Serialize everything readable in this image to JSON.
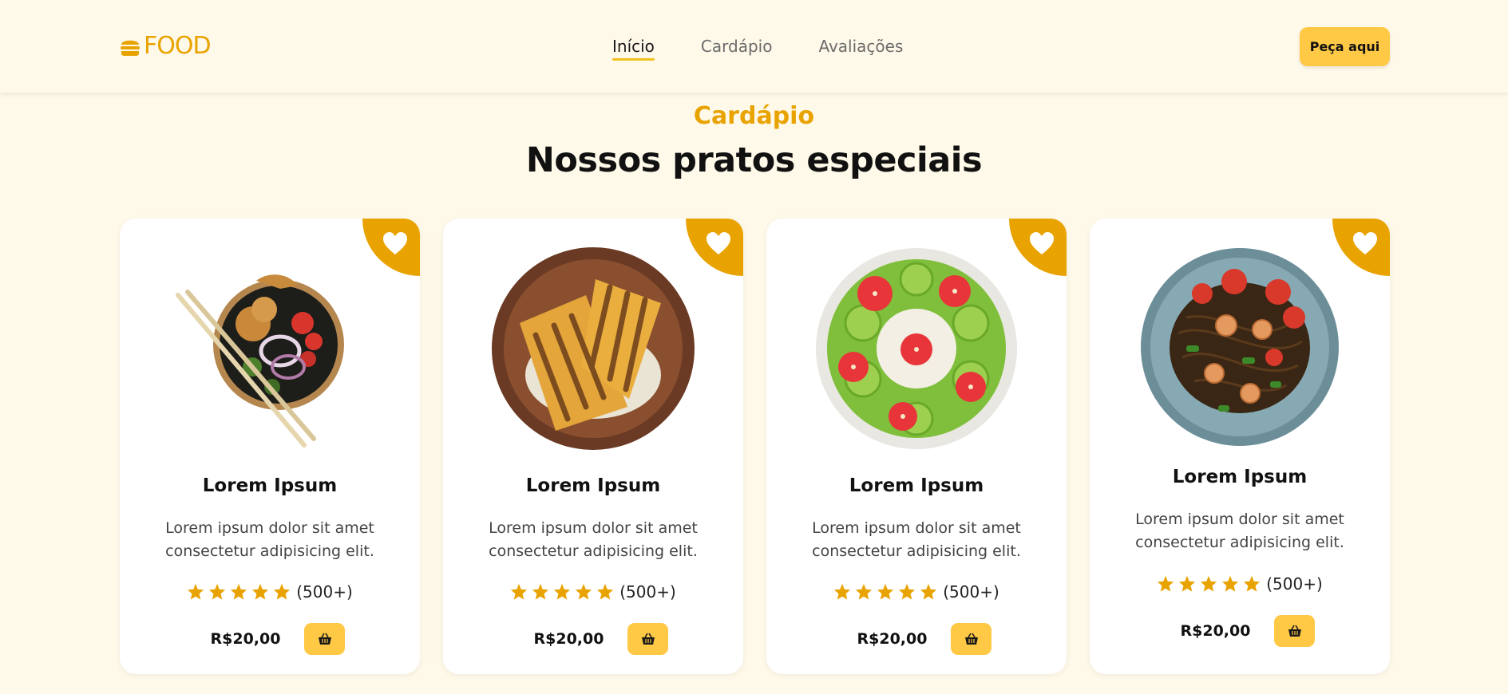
{
  "header": {
    "logo_text": "FOOD",
    "nav": [
      {
        "label": "Início",
        "active": true
      },
      {
        "label": "Cardápio",
        "active": false
      },
      {
        "label": "Avaliações",
        "active": false
      }
    ],
    "order_button": "Peça aqui"
  },
  "section": {
    "label": "Cardápio",
    "title": "Nossos pratos especiais"
  },
  "cards": [
    {
      "name": "Lorem Ipsum",
      "description": "Lorem ipsum dolor sit amet consectetur adipisicing elit.",
      "stars": 5,
      "rating_count": "(500+)",
      "price": "R$20,00",
      "dish_icon": "poke-bowl-icon"
    },
    {
      "name": "Lorem Ipsum",
      "description": "Lorem ipsum dolor sit amet consectetur adipisicing elit.",
      "stars": 5,
      "rating_count": "(500+)",
      "price": "R$20,00",
      "dish_icon": "grilled-sandwich-icon"
    },
    {
      "name": "Lorem Ipsum",
      "description": "Lorem ipsum dolor sit amet consectetur adipisicing elit.",
      "stars": 5,
      "rating_count": "(500+)",
      "price": "R$20,00",
      "dish_icon": "smoothie-bowl-icon"
    },
    {
      "name": "Lorem Ipsum",
      "description": "Lorem ipsum dolor sit amet consectetur adipisicing elit.",
      "stars": 5,
      "rating_count": "(500+)",
      "price": "R$20,00",
      "dish_icon": "noodles-plate-icon"
    }
  ],
  "colors": {
    "background": "#fff9ea",
    "accent": "#e9a300",
    "button": "#ffc845",
    "nav_underline": "#f2c21b"
  }
}
